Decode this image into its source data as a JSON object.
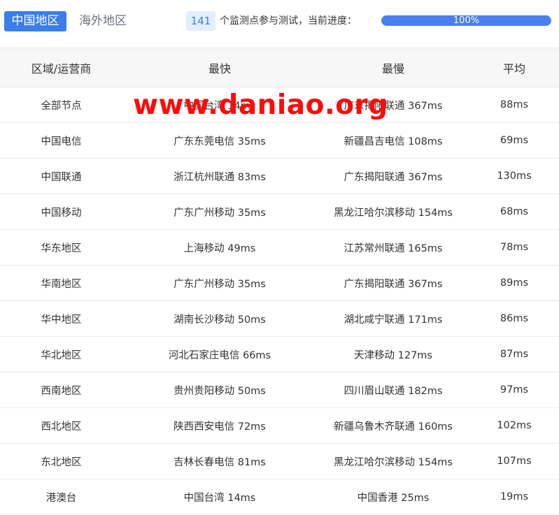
{
  "tabs": [
    {
      "label": "中国地区",
      "active": true
    },
    {
      "label": "海外地区",
      "active": false
    }
  ],
  "progress": {
    "node_count": "141",
    "text": "个监测点参与测试，当前进度：",
    "percent_label": "100%",
    "fraction": 1.0
  },
  "colors": {
    "accent": "#3a7ee8",
    "progress_fill": "#4a7ff0",
    "watermark": "#ff0a0a"
  },
  "table": {
    "headers": [
      "区域/运营商",
      "最快",
      "最慢",
      "平均"
    ],
    "rows": [
      [
        "全部节点",
        "中国台湾 14ms",
        "广东揭阳联通 367ms",
        "88ms"
      ],
      [
        "中国电信",
        "广东东莞电信 35ms",
        "新疆昌吉电信 108ms",
        "69ms"
      ],
      [
        "中国联通",
        "浙江杭州联通 83ms",
        "广东揭阳联通 367ms",
        "130ms"
      ],
      [
        "中国移动",
        "广东广州移动 35ms",
        "黑龙江哈尔滨移动 154ms",
        "68ms"
      ],
      [
        "华东地区",
        "上海移动 49ms",
        "江苏常州联通 165ms",
        "78ms"
      ],
      [
        "华南地区",
        "广东广州移动 35ms",
        "广东揭阳联通 367ms",
        "89ms"
      ],
      [
        "华中地区",
        "湖南长沙移动 50ms",
        "湖北咸宁联通 171ms",
        "86ms"
      ],
      [
        "华北地区",
        "河北石家庄电信 66ms",
        "天津移动 127ms",
        "87ms"
      ],
      [
        "西南地区",
        "贵州贵阳移动 50ms",
        "四川眉山联通 182ms",
        "97ms"
      ],
      [
        "西北地区",
        "陕西西安电信 72ms",
        "新疆乌鲁木齐联通 160ms",
        "102ms"
      ],
      [
        "东北地区",
        "吉林长春电信 81ms",
        "黑龙江哈尔滨移动 154ms",
        "107ms"
      ],
      [
        "港澳台",
        "中国台湾 14ms",
        "中国香港 25ms",
        "19ms"
      ]
    ]
  },
  "watermark": "www.daniao.org"
}
